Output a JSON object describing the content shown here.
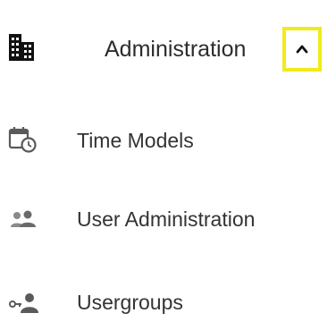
{
  "header": {
    "label": "Administration",
    "icon": "building-icon",
    "toggle_icon": "chevron-up-icon",
    "highlight_color": "#f2ea1a"
  },
  "items": [
    {
      "label": "Time Models",
      "icon": "calendar-clock-icon"
    },
    {
      "label": "User Administration",
      "icon": "people-icon"
    },
    {
      "label": "Usergroups",
      "icon": "person-key-icon"
    }
  ]
}
